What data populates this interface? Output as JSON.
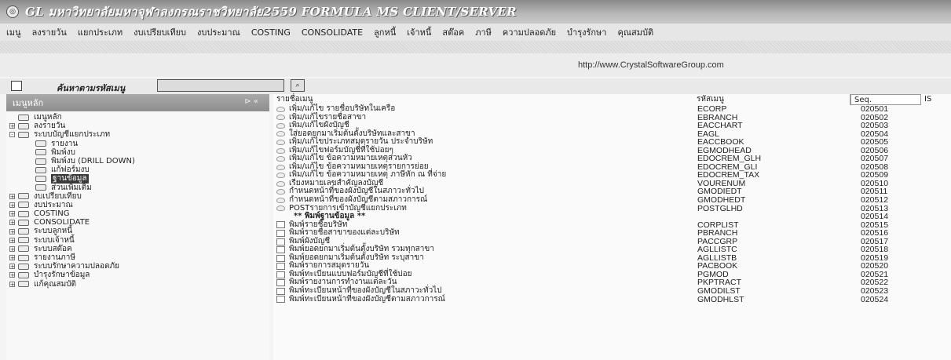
{
  "window": {
    "title": "GL มหาวิทยาลัยมหาจุฬาลงกรณราชวิทยาลัย2559 FORMULA MS CLIENT/SERVER",
    "icon": "gl-app-icon"
  },
  "menu": [
    "เมนู",
    "ลงรายวัน",
    "แยกประเภท",
    "งบเปรียบเทียบ",
    "งบประมาณ",
    "COSTING",
    "CONSOLIDATE",
    "ลูกหนี้",
    "เจ้าหนี้",
    "สต๊อค",
    "ภาษี",
    "ความปลอดภัย",
    "บำรุงรักษา",
    "คุณสมบัติ"
  ],
  "url": "http://www.CrystalSoftwareGroup.com",
  "search": {
    "label": "ค้นหาตามรหัสเมนู",
    "value": "",
    "button_icon": "search-icon"
  },
  "left_panel": {
    "header": "เมนูหลัก",
    "header_icon": "pin-icon",
    "tree": [
      {
        "label": "เมนูหลัก",
        "level": 0,
        "expander": "",
        "selected": false
      },
      {
        "label": "ลงรายวัน",
        "level": 0,
        "expander": "+",
        "selected": false
      },
      {
        "label": "ระบบบัญชีแยกประเภท",
        "level": 0,
        "expander": "-",
        "selected": false
      },
      {
        "label": "รายงาน",
        "level": 1,
        "expander": "",
        "selected": false
      },
      {
        "label": "พิมพ์งบ",
        "level": 1,
        "expander": "",
        "selected": false
      },
      {
        "label": "พิมพ์งบ (DRILL DOWN)",
        "level": 1,
        "expander": "",
        "selected": false
      },
      {
        "label": "แก้ฟอร์มงบ",
        "level": 1,
        "expander": "",
        "selected": false
      },
      {
        "label": "ฐานข้อมูล",
        "level": 1,
        "expander": "",
        "selected": true
      },
      {
        "label": "ส่วนเพิ่มเติม",
        "level": 1,
        "expander": "",
        "selected": false
      },
      {
        "label": "งบเปรียบเทียบ",
        "level": 0,
        "expander": "+",
        "selected": false
      },
      {
        "label": "งบประมาณ",
        "level": 0,
        "expander": "+",
        "selected": false
      },
      {
        "label": "COSTING",
        "level": 0,
        "expander": "+",
        "selected": false
      },
      {
        "label": "CONSOLIDATE",
        "level": 0,
        "expander": "+",
        "selected": false
      },
      {
        "label": "ระบบลูกหนี้",
        "level": 0,
        "expander": "+",
        "selected": false
      },
      {
        "label": "ระบบเจ้าหนี้",
        "level": 0,
        "expander": "+",
        "selected": false
      },
      {
        "label": "ระบบสต๊อค",
        "level": 0,
        "expander": "+",
        "selected": false
      },
      {
        "label": "รายงานภาษี",
        "level": 0,
        "expander": "+",
        "selected": false
      },
      {
        "label": "ระบบรักษาความปลอดภัย",
        "level": 0,
        "expander": "+",
        "selected": false
      },
      {
        "label": "บำรุงรักษาข้อมูล",
        "level": 0,
        "expander": "+",
        "selected": false
      },
      {
        "label": "แก้คุณสมบัติ",
        "level": 0,
        "expander": "+",
        "selected": false
      }
    ]
  },
  "grid": {
    "columns": [
      "รายชื่อเมนู",
      "รหัสเมนู",
      "Seq.",
      "IS"
    ],
    "rows": [
      {
        "name": "เพิ่ม/แก้ไข รายชื่อบริษัทในเครือ",
        "code": "ECORP",
        "seq": "020501",
        "icon": "gear-icon",
        "heading": false
      },
      {
        "name": "เพิ่ม/แก้ไขรายชื่อสาขา",
        "code": "EBRANCH",
        "seq": "020502",
        "icon": "gear-icon",
        "heading": false
      },
      {
        "name": "เพิ่ม/แก้ไขผังบัญชี",
        "code": "EACCHART",
        "seq": "020503",
        "icon": "gear-icon",
        "heading": false
      },
      {
        "name": "ใส่ยอดยกมาเริ่มต้นตั้งบริษัทและสาขา",
        "code": "EAGL",
        "seq": "020504",
        "icon": "gear-icon",
        "heading": false
      },
      {
        "name": "เพิ่ม/แก้ไขประเภทสมุดรายวัน ประจำบริษัท",
        "code": "EACCBOOK",
        "seq": "020505",
        "icon": "gear-icon",
        "heading": false
      },
      {
        "name": "เพิ่ม/แก้ไขฟอร์มบัญชีที่ใช้บ่อยๆ",
        "code": "EGMODHEAD",
        "seq": "020506",
        "icon": "gear-icon",
        "heading": false
      },
      {
        "name": "เพิ่ม/แก้ไข ข้อความหมายเหตุส่วนหัว",
        "code": "EDOCREM_GLH",
        "seq": "020507",
        "icon": "gear-icon",
        "heading": false
      },
      {
        "name": "เพิ่ม/แก้ไข ข้อความหมายเหตุรายการย่อย",
        "code": "EDOCREM_GLI",
        "seq": "020508",
        "icon": "gear-icon",
        "heading": false
      },
      {
        "name": "เพิ่ม/แก้ไข ข้อความหมายเหตุ ภาษีหัก ณ ที่จ่าย",
        "code": "EDOCREM_TAX",
        "seq": "020509",
        "icon": "gear-icon",
        "heading": false
      },
      {
        "name": "เรียงหมายเลขสำคัญลงบัญชี",
        "code": "VOURENUM",
        "seq": "020510",
        "icon": "gear-icon",
        "heading": false
      },
      {
        "name": "กำหนดหน้าที่ของผังบัญชีในสภาวะทั่วไป",
        "code": "GMODIEDT",
        "seq": "020511",
        "icon": "gear-icon",
        "heading": false
      },
      {
        "name": "กำหนดหน้าที่ของผังบัญชีตามสภาวการณ์",
        "code": "GMODHEDT",
        "seq": "020512",
        "icon": "gear-icon",
        "heading": false
      },
      {
        "name": "POSTรายการเข้าบัญชีแยกประเภท",
        "code": "POSTGLHD",
        "seq": "020513",
        "icon": "gear-icon",
        "heading": false
      },
      {
        "name": "** พิมพ์ฐานข้อมูล **",
        "code": "",
        "seq": "020514",
        "icon": "",
        "heading": true
      },
      {
        "name": "พิมพ์รายชื่อบริษัท",
        "code": "CORPLIST",
        "seq": "020515",
        "icon": "document-icon",
        "heading": false
      },
      {
        "name": "พิมพ์รายชื่อสาขาของแต่ละบริษัท",
        "code": "PBRANCH",
        "seq": "020516",
        "icon": "document-icon",
        "heading": false
      },
      {
        "name": "พิมพ์ผังบัญชี",
        "code": "PACCGRP",
        "seq": "020517",
        "icon": "document-icon",
        "heading": false
      },
      {
        "name": "พิมพ์ยอดยกมาเริ่มต้นตั้งบริษัท รวมทุกสาขา",
        "code": "AGLLISTC",
        "seq": "020518",
        "icon": "document-icon",
        "heading": false
      },
      {
        "name": "พิมพ์ยอดยกมาเริ่มต้นตั้งบริษัท ระบุสาขา",
        "code": "AGLLISTB",
        "seq": "020519",
        "icon": "document-icon",
        "heading": false
      },
      {
        "name": "พิมพ์รายการสมุดรายวัน",
        "code": "PACBOOK",
        "seq": "020520",
        "icon": "document-icon",
        "heading": false
      },
      {
        "name": "พิมพ์ทะเบียนแบบฟอร์มบัญชีที่ใช้บ่อย",
        "code": "PGMOD",
        "seq": "020521",
        "icon": "document-icon",
        "heading": false
      },
      {
        "name": "พิมพ์รายงานการทำงานแต่ละวัน",
        "code": "PKPTRACT",
        "seq": "020522",
        "icon": "document-icon",
        "heading": false
      },
      {
        "name": "พิมพ์ทะเบียนหน้าที่ของผังบัญชีในสภาวะทั่วไป",
        "code": "GMODILST",
        "seq": "020523",
        "icon": "document-icon",
        "heading": false
      },
      {
        "name": "พิมพ์ทะเบียนหน้าที่ของผังบัญชีตามสภาวการณ์",
        "code": "GMODHLST",
        "seq": "020524",
        "icon": "document-icon",
        "heading": false
      }
    ]
  }
}
